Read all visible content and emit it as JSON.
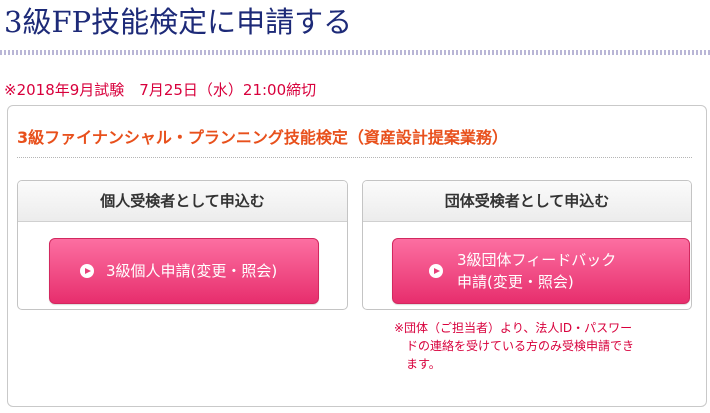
{
  "header": {
    "title": "3級FP技能検定に申請する"
  },
  "exam": {
    "deadline": "※2018年9月試験　7月25日（水）21:00締切",
    "name": "3級ファイナンシャル・プランニング技能検定（資産設計提案業務）"
  },
  "individual": {
    "heading": "個人受検者として申込む",
    "button_label": "3級個人申請(変更・照会)"
  },
  "group": {
    "heading": "団体受検者として申込む",
    "button_line1": "3級団体フィードバック",
    "button_line2": "申請(変更・照会)",
    "note_line1": "※団体（ご担当者）より、法人ID・パスワー",
    "note_line2": "ドの連絡を受けている方のみ受検申請でき",
    "note_line3": "ます。"
  },
  "colors": {
    "title": "#1d2a78",
    "accent_red": "#d8003c",
    "exam_name": "#e8501c",
    "button_pink": "#f0447f"
  },
  "icons": [
    "play-circle-icon"
  ]
}
